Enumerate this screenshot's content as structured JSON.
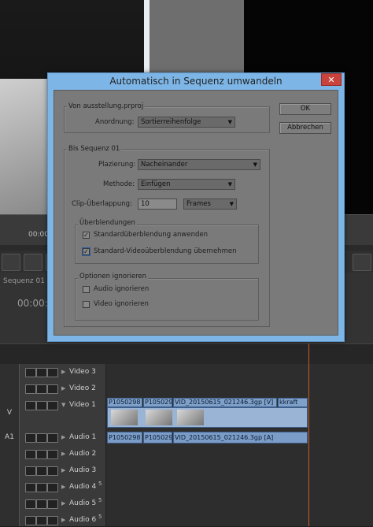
{
  "dialog": {
    "title": "Automatisch in Sequenz umwandeln",
    "close_glyph": "✕",
    "ok_label": "OK",
    "cancel_label": "Abbrechen",
    "source_group": {
      "legend": "Von ausstellung.prproj",
      "anordnung_label": "Anordnung:",
      "anordnung_value": "Sortierreihenfolge"
    },
    "target_group": {
      "legend": "Bis Sequenz 01",
      "platzierung_label": "Plazierung:",
      "platzierung_value": "Nacheinander",
      "methode_label": "Methode:",
      "methode_value": "Einfügen",
      "clip_ueberlappung_label": "Clip-Überlappung:",
      "clip_ueberlappung_value": "10",
      "unit_value": "Frames"
    },
    "transitions_group": {
      "legend": "Überblendungen",
      "standard_transition": {
        "label": "Standardüberblendung anwenden",
        "checked": true
      },
      "standard_video_transition": {
        "label": "Standard-Videoüberblendung übernehmen",
        "checked": true
      }
    },
    "ignore_group": {
      "legend": "Optionen ignorieren",
      "audio": {
        "label": "Audio ignorieren",
        "checked": false
      },
      "video": {
        "label": "Video ignorieren",
        "checked": false
      }
    }
  },
  "background": {
    "ruler_time": "00:00",
    "sequence_title": "Sequenz 01",
    "sequence_timecode": "00:00:",
    "tracks": {
      "video3": "Video 3",
      "video2": "Video 2",
      "video1": "Video 1",
      "audio1": "Audio 1",
      "audio2": "Audio 2",
      "audio3": "Audio 3",
      "audio4": "Audio 4",
      "audio5": "Audio 5",
      "audio6": "Audio 6",
      "v_tag": "V",
      "a1_tag": "A1",
      "s5_badge": "5"
    },
    "clips": {
      "v_clip1": "P1050298",
      "v_clip2": "P105029",
      "v_clip3": "VID_20150615_021246.3gp [V]",
      "v_clip4": "kkraft",
      "a_clip1": "P1050298",
      "a_clip2": "P105029",
      "a_clip3": "VID_20150615_021246.3gp [A]"
    }
  },
  "colors": {
    "dialog_frame": "#7db6e6",
    "close_button": "#c9423b",
    "clip_blue": "#7fa0c8",
    "playhead": "#c85a28"
  }
}
